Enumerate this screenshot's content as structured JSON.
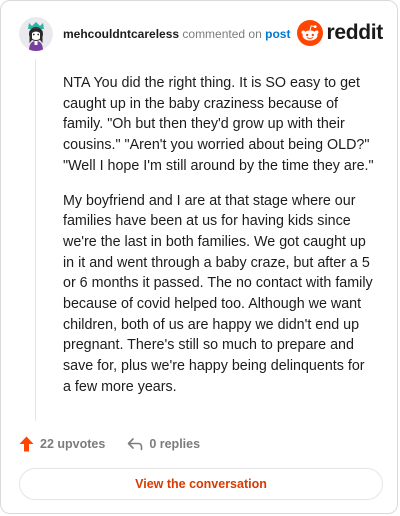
{
  "comment": {
    "username": "mehcouldntcareless",
    "action_text": "commented on",
    "link_text": "post",
    "paragraphs": [
      "NTA You did the right thing. It is SO easy to get caught up in the baby craziness because of family. \"Oh but then they'd grow up with their cousins.\" \"Aren't you worried about being OLD?\" \"Well I hope I'm still around by the time they are.\"",
      "My boyfriend and I are at that stage where our families have been at us for having kids since we're the last in both families. We got caught up in it and went through a baby craze, but after a 5 or 6 months it passed. The no contact with family because of covid helped too. Although we want children, both of us are happy we didn't end up pregnant. There's still so much to prepare and save for, plus we're happy being delinquents for a few more years."
    ]
  },
  "brand": {
    "wordmark": "reddit",
    "icon": "reddit-snoo-icon",
    "color": "#ff4500"
  },
  "actions": {
    "upvotes_label": "22 upvotes",
    "replies_label": "0 replies",
    "upvote_icon": "upvote-arrow-icon",
    "reply_icon": "reply-arrow-icon"
  },
  "cta": {
    "label": "View the conversation",
    "color": "#d93a00"
  },
  "colors": {
    "upvote": "#ff4500",
    "link": "#0079d3",
    "muted": "#7c7c7c"
  }
}
